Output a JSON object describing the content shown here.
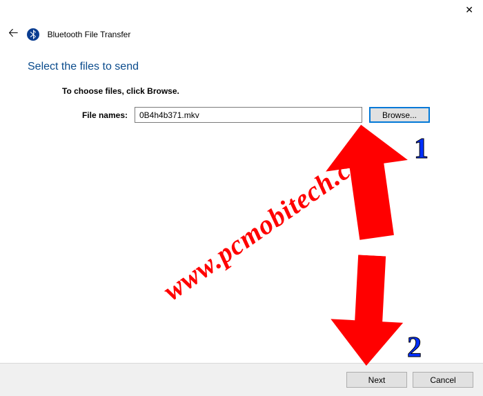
{
  "window": {
    "title": "Bluetooth File Transfer"
  },
  "heading": "Select the files to send",
  "instruction": "To choose files, click Browse.",
  "fileRow": {
    "label": "File names:",
    "value": "0B4h4b371.mkv",
    "browseLabel": "Browse..."
  },
  "footer": {
    "next": "Next",
    "cancel": "Cancel"
  },
  "annotations": {
    "num1": "1",
    "num2": "2",
    "watermark": "www.pcmobitech.com"
  }
}
